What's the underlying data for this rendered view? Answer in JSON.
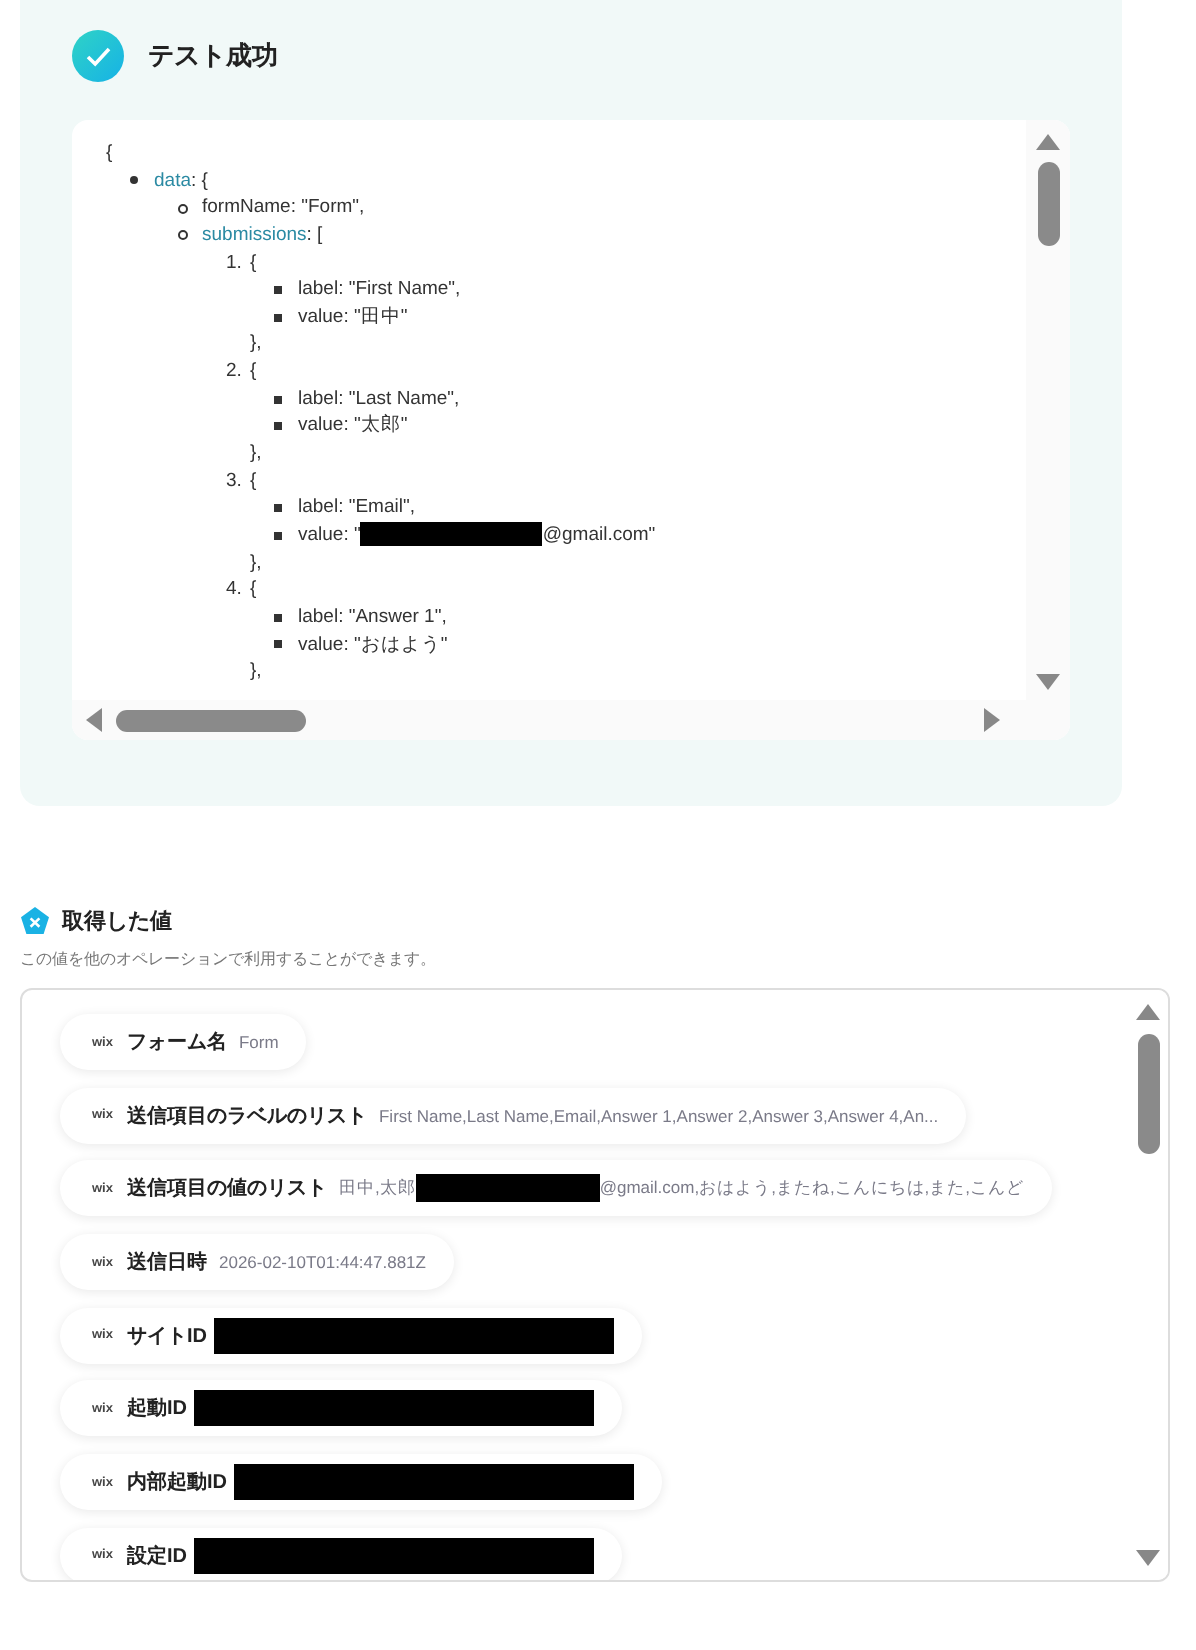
{
  "test_result": {
    "title": "テスト成功",
    "code": {
      "open": "{",
      "items": [
        {
          "kind": "bullet",
          "key": "data",
          "linked": true,
          "text": ": {",
          "children": [
            {
              "kind": "bullet",
              "key": "formName",
              "linked": false,
              "text": ": \"Form\","
            },
            {
              "kind": "bullet",
              "key": "submissions",
              "linked": true,
              "text": ": [",
              "children": [
                {
                  "kind": "numbered",
                  "number": "1.",
                  "text": "{",
                  "close": "},",
                  "children": [
                    {
                      "kind": "bullet",
                      "text": "label: \"First Name\","
                    },
                    {
                      "kind": "bullet",
                      "text": "value: \"田中\""
                    }
                  ]
                },
                {
                  "kind": "numbered",
                  "number": "2.",
                  "text": "{",
                  "close": "},",
                  "children": [
                    {
                      "kind": "bullet",
                      "text": "label: \"Last Name\","
                    },
                    {
                      "kind": "bullet",
                      "text": "value: \"太郎\""
                    }
                  ]
                },
                {
                  "kind": "numbered",
                  "number": "3.",
                  "text": "{",
                  "close": "},",
                  "children": [
                    {
                      "kind": "bullet",
                      "text": "label: \"Email\","
                    },
                    {
                      "kind": "bullet",
                      "text": "value: \"",
                      "redacted": true,
                      "suffix": "@gmail.com\""
                    }
                  ]
                },
                {
                  "kind": "numbered",
                  "number": "4.",
                  "text": "{",
                  "close": "},",
                  "children": [
                    {
                      "kind": "bullet",
                      "text": "label: \"Answer 1\","
                    },
                    {
                      "kind": "bullet",
                      "text": "value: \"おはよう\""
                    }
                  ]
                }
              ]
            }
          ]
        }
      ]
    }
  },
  "values": {
    "title": "取得した値",
    "description": "この値を他のオペレーションで利用することができます。",
    "items": [
      {
        "source": "wix",
        "name": "フォーム名",
        "value": "Form",
        "redacted": false
      },
      {
        "source": "wix",
        "name": "送信項目のラベルのリスト",
        "value": "First Name,Last Name,Email,Answer 1,Answer 2,Answer 3,Answer 4,An...",
        "redacted": false
      },
      {
        "source": "wix",
        "name": "送信項目の値のリスト",
        "value": "田中,太郎",
        "redacted": true,
        "value_after": "@gmail.com,おはよう,またね,こんにちは,また,こんど"
      },
      {
        "source": "wix",
        "name": "送信日時",
        "value": "2026-02-10T01:44:47.881Z",
        "redacted": false
      },
      {
        "source": "wix",
        "name": "サイトID",
        "redacted": true
      },
      {
        "source": "wix",
        "name": "起動ID",
        "redacted": true
      },
      {
        "source": "wix",
        "name": "内部起動ID",
        "redacted": true
      },
      {
        "source": "wix",
        "name": "設定ID",
        "redacted": true
      }
    ]
  }
}
